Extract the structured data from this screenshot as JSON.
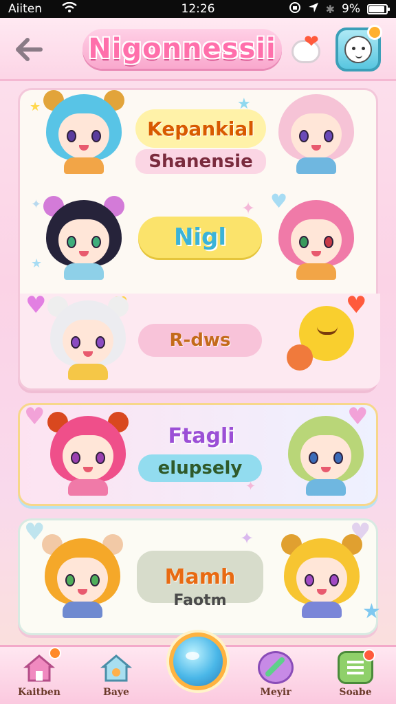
{
  "status_bar": {
    "carrier": "Aiiten",
    "time": "12:26",
    "battery": "9%",
    "battery_level": 0.9
  },
  "header": {
    "back_label": "←",
    "title": "Nigonnessii"
  },
  "cards": [
    {
      "rows": [
        {
          "label": "Kepankial",
          "sublabel": "Shanensie",
          "left_char": "blue-hair-ram-horns",
          "right_char": "pink-hair-headband"
        },
        {
          "label": "Nigl",
          "left_char": "dark-hair-pink-buns",
          "right_char": "pink-hair-blush"
        },
        {
          "label": "R-dws",
          "left_char": "white-hair-bear-ears",
          "right_char": "yellow-cat-creature"
        }
      ]
    },
    {
      "rows": [
        {
          "label": "Ftagli",
          "sublabel": "elupsely",
          "left_char": "magenta-hair-ram-horns",
          "right_char": "green-hair-girl"
        }
      ]
    },
    {
      "rows": [
        {
          "label": "Mamh",
          "sublabel": "Faotm",
          "left_char": "orange-hair-bear-ears",
          "right_char": "yellow-hair-ram-horns"
        }
      ]
    }
  ],
  "bottom_nav": {
    "items": [
      {
        "label": "Kaitben",
        "icon": "house-icon"
      },
      {
        "label": "Baye",
        "icon": "home-shop-icon"
      },
      {
        "label": "",
        "icon": "orb-icon"
      },
      {
        "label": "Meyir",
        "icon": "potion-icon"
      },
      {
        "label": "Soabe",
        "icon": "menu-list-icon"
      }
    ]
  },
  "colors": {
    "accent_pink": "#ff6fab",
    "pill_yellow": "#fbe36b",
    "pill_pink": "#f8c3d9",
    "pill_blue": "#92dcef",
    "pill_gray": "#d7dccb"
  }
}
